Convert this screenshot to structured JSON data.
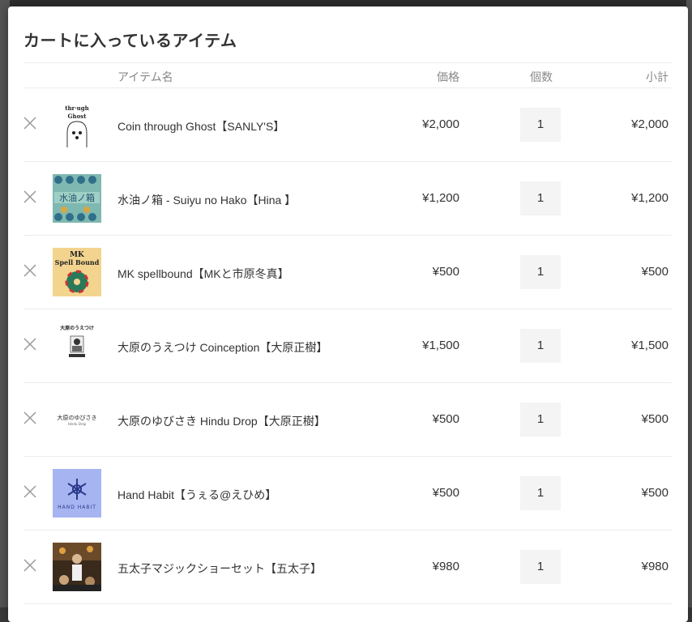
{
  "modal": {
    "title": "カートに入っているアイテム"
  },
  "table": {
    "headers": {
      "item": "アイテム名",
      "price": "価格",
      "qty": "個数",
      "subtotal": "小計"
    },
    "rows": [
      {
        "name": "Coin through Ghost【SANLY'S】",
        "price": "¥2,000",
        "qty": "1",
        "subtotal": "¥2,000",
        "thumb_text": "through Ghost"
      },
      {
        "name": "水油ノ箱 - Suiyu no Hako【Hina 】",
        "price": "¥1,200",
        "qty": "1",
        "subtotal": "¥1,200",
        "thumb_text": "水油ノ箱"
      },
      {
        "name": "MK spellbound【MKと市原冬真】",
        "price": "¥500",
        "qty": "1",
        "subtotal": "¥500",
        "thumb_text": "MK Spell Bound"
      },
      {
        "name": "大原のうえつけ Coinception【大原正樹】",
        "price": "¥1,500",
        "qty": "1",
        "subtotal": "¥1,500",
        "thumb_text": "大原のうえつけ"
      },
      {
        "name": "大原のゆびさき Hindu Drop【大原正樹】",
        "price": "¥500",
        "qty": "1",
        "subtotal": "¥500",
        "thumb_text": "大原のゆびさき"
      },
      {
        "name": "Hand Habit【うぇる@えひめ】",
        "price": "¥500",
        "qty": "1",
        "subtotal": "¥500",
        "thumb_text": "HAND HABIT"
      },
      {
        "name": "五太子マジックショーセット【五太子】",
        "price": "¥980",
        "qty": "1",
        "subtotal": "¥980",
        "thumb_text": ""
      }
    ]
  }
}
